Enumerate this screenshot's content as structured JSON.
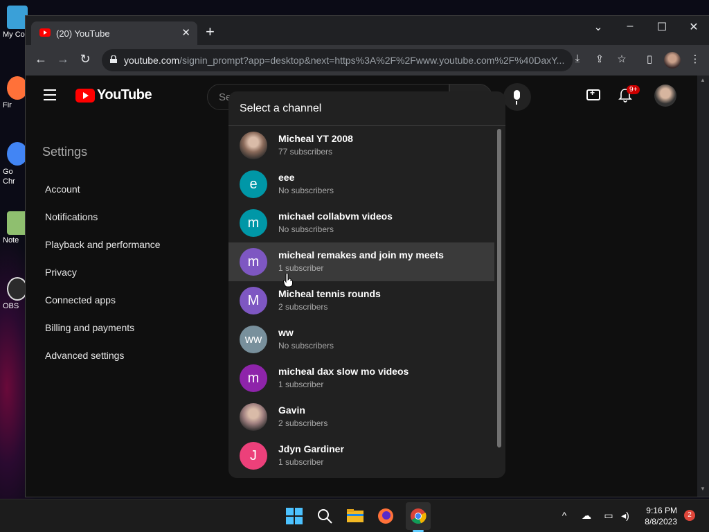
{
  "desktop": {
    "icons": [
      {
        "label": "My Co",
        "color": "#3aa0d8"
      },
      {
        "label": "Fir",
        "color": "#ff7139"
      },
      {
        "label": "Go\nChr",
        "color": "#4285f4"
      },
      {
        "label": "Note",
        "color": "#8fbf6f"
      },
      {
        "label": "OBS",
        "color": "#2b2b2b"
      }
    ]
  },
  "browser": {
    "tab_title": "(20) YouTube",
    "tab_close": "✕",
    "new_tab": "+",
    "url_host": "youtube.com",
    "url_path": "/signin_prompt?app=desktop&next=https%3A%2F%2Fwww.youtube.com%2F%40DaxY..."
  },
  "youtube": {
    "logo_text": "YouTube",
    "search_placeholder": "Search",
    "notification_count": "9+",
    "settings": {
      "title": "Settings",
      "items": [
        "Account",
        "Notifications",
        "Playback and performance",
        "Privacy",
        "Connected apps",
        "Billing and payments",
        "Advanced settings"
      ]
    }
  },
  "dialog": {
    "title": "Select a channel",
    "channels": [
      {
        "name": "Micheal YT 2008",
        "subs": "77 subscribers",
        "initial": "",
        "color": "#8a6a5a",
        "photo": true
      },
      {
        "name": "eee",
        "subs": "No subscribers",
        "initial": "e",
        "color": "#0097a7"
      },
      {
        "name": "michael collabvm videos",
        "subs": "No subscribers",
        "initial": "m",
        "color": "#0097a7"
      },
      {
        "name": "micheal remakes and join my meets",
        "subs": "1 subscriber",
        "initial": "m",
        "color": "#7e57c2",
        "hover": true
      },
      {
        "name": "Micheal tennis rounds",
        "subs": "2 subscribers",
        "initial": "M",
        "color": "#7e57c2"
      },
      {
        "name": "ww",
        "subs": "No subscribers",
        "initial": "ww",
        "color": "#78909c"
      },
      {
        "name": "micheal dax slow mo videos",
        "subs": "1 subscriber",
        "initial": "m",
        "color": "#8e24aa"
      },
      {
        "name": "Gavin",
        "subs": "2 subscribers",
        "initial": "",
        "color": "#a08080",
        "photo": true
      },
      {
        "name": "Jdyn Gardiner",
        "subs": "1 subscriber",
        "initial": "J",
        "color": "#ec407a"
      }
    ]
  },
  "taskbar": {
    "time": "9:16 PM",
    "date": "8/8/2023",
    "notification_count": "2"
  }
}
